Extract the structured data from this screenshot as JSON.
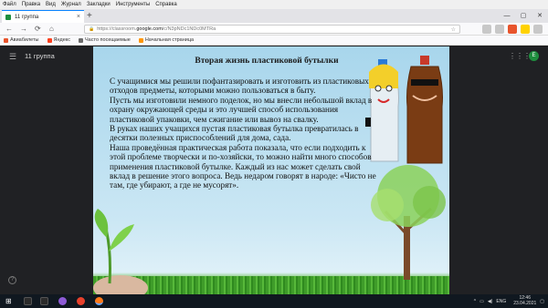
{
  "menu": [
    "Файл",
    "Правка",
    "Вид",
    "Журнал",
    "Закладки",
    "Инструменты",
    "Справка"
  ],
  "tab": {
    "title": "11 группа",
    "close": "×",
    "new": "+"
  },
  "window_controls": [
    "—",
    "▢",
    "✕"
  ],
  "nav": {
    "back": "←",
    "forward": "→",
    "reload": "⟳",
    "home": "⌂"
  },
  "url": {
    "prefix": "https://classroom.",
    "domain": "google.com",
    "rest": "/c/N3pNDc1NDc0MTRa"
  },
  "bookmarks": [
    {
      "label": "Авиабилеты",
      "color": "#e8542c"
    },
    {
      "label": "Яндекс",
      "color": "#fc3f1d"
    },
    {
      "label": "Часто посещаемые",
      "color": "#6b6b6b"
    },
    {
      "label": "Начальная страница",
      "color": "#ff9500"
    }
  ],
  "app": {
    "menu_icon": "☰",
    "group": "11 группа",
    "apps_icon": "⋮⋮⋮",
    "avatar": "Е",
    "help": "?"
  },
  "slide": {
    "title": "Вторая жизнь пластиковой бутылки",
    "paragraphs": [
      "С учащимися мы решили пофантазировать и изготовить из пластиковых отходов предметы, которыми можно пользоваться в быту.",
      "Пусть мы изготовили немного поделок, но мы внесли небольшой вклад в охрану окружающей среды и это лучшей способ использования пластиковой упаковки, чем сжигание или вывоз на свалку.",
      "В руках наших учащихся пустая пластиковая бутылка превратилась в десятки полезных приспособлений для дома, сада.",
      "Наша проведённая практическая работа показала, что если подходить к этой проблеме творчески и по-хозяйски, то можно найти много способов применения пластиковой бутылке. Каждый из нас может сделать свой вклад в решение этого вопроса. Ведь недаром говорят в народе: «Чисто не там, где убирают, а где не мусорят»."
    ]
  },
  "taskbar": {
    "start": "⊞",
    "lang": "ENG",
    "time": "12:46",
    "date": "23.04.2021",
    "apps": [
      {
        "name": "search",
        "color": "#2b2b2b"
      },
      {
        "name": "task-view",
        "color": "#2b2b2b"
      },
      {
        "name": "purple-app",
        "color": "#8e5bd6"
      },
      {
        "name": "yandex-browser",
        "color": "#e8412c"
      },
      {
        "name": "firefox",
        "color": "#ff7a1a"
      }
    ]
  }
}
